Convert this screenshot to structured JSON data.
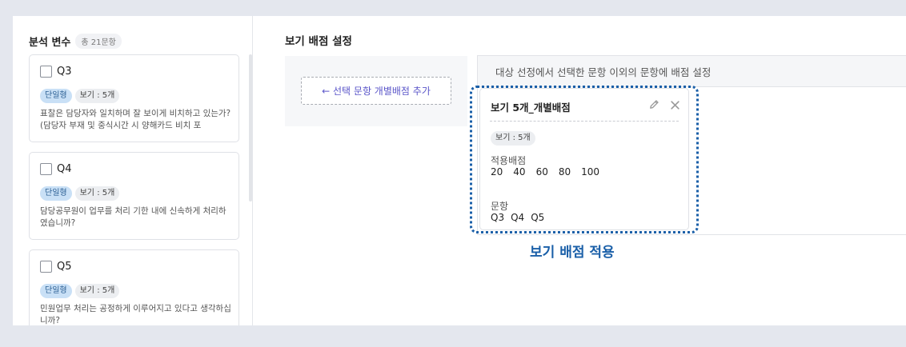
{
  "sidebar": {
    "title": "분석 변수",
    "count": "총 21문항",
    "items": [
      {
        "label": "Q3",
        "type": "단일형",
        "count": "보기 :  5개",
        "text": "표찰은 담당자와 일치하며 잘 보이게 비치하고 있는가? (담당자 부재 및 중식시간 시 양해카드 비치 포"
      },
      {
        "label": "Q4",
        "type": "단일형",
        "count": "보기 :  5개",
        "text": "담당공무원이 업무를 처리 기한 내에 신속하게 처리하였습니까?"
      },
      {
        "label": "Q5",
        "type": "단일형",
        "count": "보기 :  5개",
        "text": "민원업무 처리는 공정하게 이루어지고 있다고 생각하십니까?"
      }
    ]
  },
  "main": {
    "section_title": "보기 배점 설정",
    "add_button": "← 선택 문항 개별배점 추가",
    "target_header": "대상 선정에서 선택한 문항 이외의 문항에 배점 설정",
    "score_card": {
      "title": "보기 5개_개별배점",
      "tag": "보기 : 5개",
      "score_label": "적용배점",
      "scores": [
        "20",
        "40",
        "60",
        "80",
        "100"
      ],
      "question_label": "문항",
      "questions": [
        "Q3",
        "Q4",
        "Q5"
      ]
    },
    "caption": "보기 배점 적용"
  },
  "colors": {
    "accent": "#1a5fa8",
    "link": "#5b56c9",
    "tag_type_bg": "#c9e0f6",
    "page_bg": "#e4e7ee"
  },
  "icons": {
    "edit": "pencil-icon",
    "close": "close-icon"
  }
}
